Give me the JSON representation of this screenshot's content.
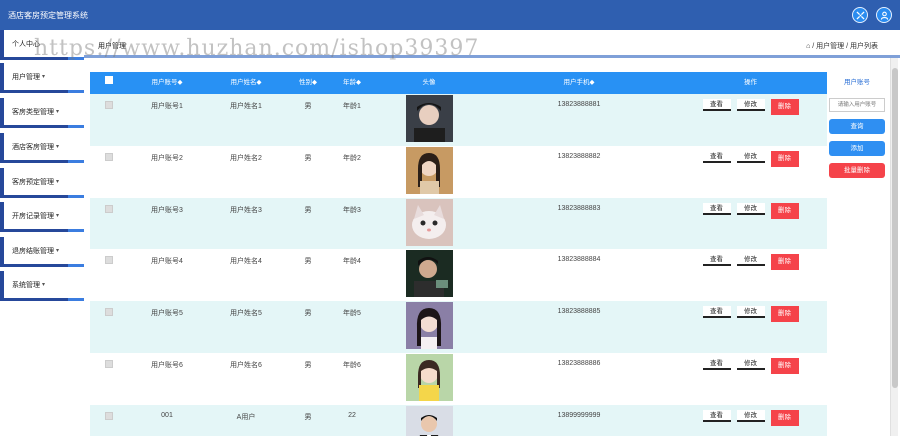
{
  "app": {
    "title": "酒店客房预定管理系统"
  },
  "header": {
    "page_title": "用户管理",
    "breadcrumb": "⌂ / 用户管理 / 用户列表"
  },
  "watermark": "https://www.huzhan.com/ishop39397",
  "sidebar": {
    "items": [
      {
        "label": "个人中心"
      },
      {
        "label": "用户管理"
      },
      {
        "label": "客房类型管理"
      },
      {
        "label": "酒店客房管理"
      },
      {
        "label": "客房预定管理"
      },
      {
        "label": "开房记录管理"
      },
      {
        "label": "退房结账管理"
      },
      {
        "label": "系统管理"
      }
    ]
  },
  "table": {
    "columns": [
      "",
      "用户账号◆",
      "用户姓名◆",
      "性别◆",
      "年龄◆",
      "头像",
      "用户手机◆",
      "操作"
    ],
    "rows": [
      {
        "account": "用户账号1",
        "name": "用户姓名1",
        "sex": "男",
        "age": "年龄1",
        "phone": "13823888881"
      },
      {
        "account": "用户账号2",
        "name": "用户姓名2",
        "sex": "男",
        "age": "年龄2",
        "phone": "13823888882"
      },
      {
        "account": "用户账号3",
        "name": "用户姓名3",
        "sex": "男",
        "age": "年龄3",
        "phone": "13823888883"
      },
      {
        "account": "用户账号4",
        "name": "用户姓名4",
        "sex": "男",
        "age": "年龄4",
        "phone": "13823888884"
      },
      {
        "account": "用户账号5",
        "name": "用户姓名5",
        "sex": "男",
        "age": "年龄5",
        "phone": "13823888885"
      },
      {
        "account": "用户账号6",
        "name": "用户姓名6",
        "sex": "男",
        "age": "年龄6",
        "phone": "13823888886"
      },
      {
        "account": "001",
        "name": "A用户",
        "sex": "男",
        "age": "22",
        "phone": "13899999999"
      }
    ],
    "actions": {
      "view": "查看",
      "edit": "修改",
      "delete": "删除"
    }
  },
  "right_panel": {
    "label": "用户账号",
    "placeholder": "请输入用户账号",
    "query": "查询",
    "add": "添加",
    "batch_delete": "批量删除"
  },
  "colors": {
    "topbar": "#2f5fb0",
    "header_row": "#2891f4",
    "row_alt": "#e4f6f7",
    "danger": "#f5434a"
  },
  "icons": {
    "top_left": "expand-icon",
    "top_right": "user-icon",
    "home": "home-icon"
  }
}
